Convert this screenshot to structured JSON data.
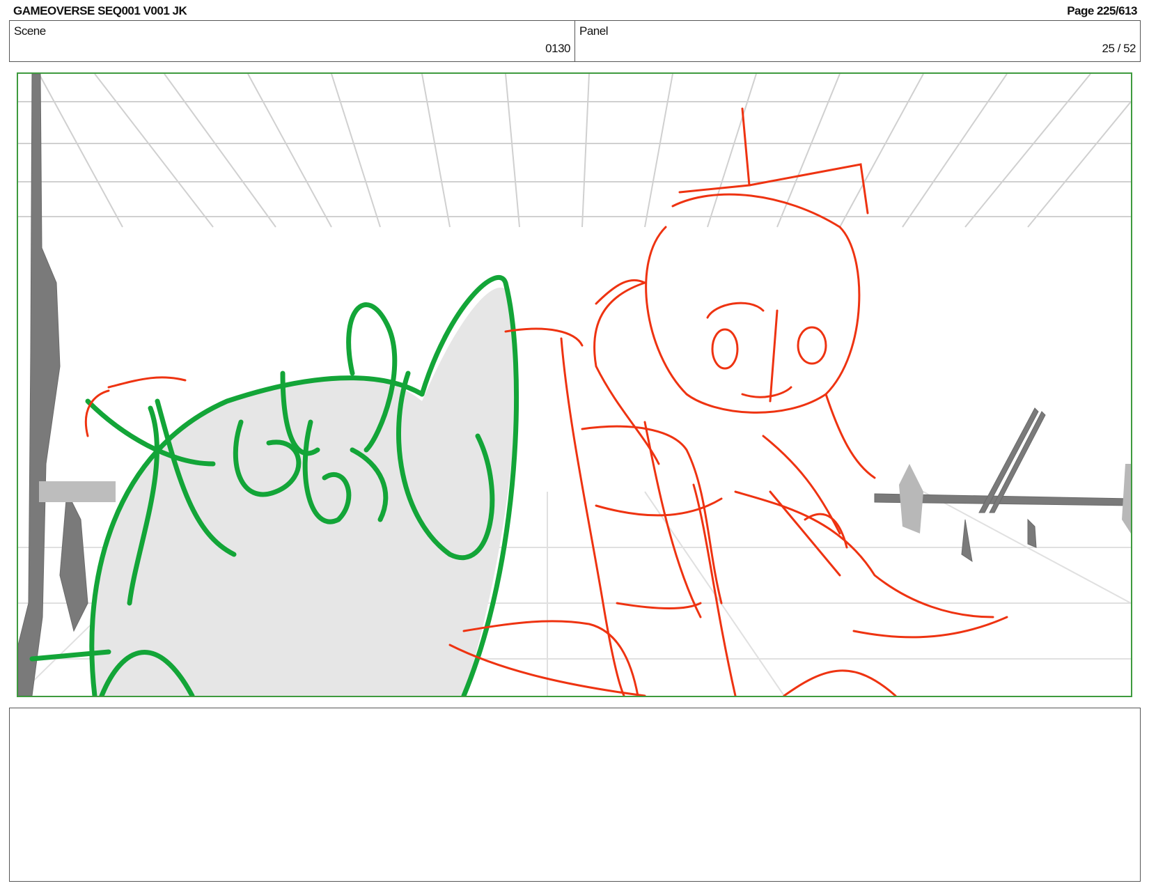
{
  "header": {
    "title": "GAMEOVERSE SEQ001 V001 JK",
    "page": "Page 225/613"
  },
  "info": {
    "scene_label": "Scene",
    "scene_value": "0130",
    "panel_label": "Panel",
    "panel_value": "25 / 52"
  },
  "panel_image": {
    "description_colors": {
      "grid": "#cfcfcf",
      "props": "#7a7a7a",
      "foreground_character": "#13a538",
      "background_character": "#ee3311",
      "fill": "#e6e6e6",
      "frame_border": "#3e9a3e"
    }
  },
  "notes": {
    "text": ""
  }
}
